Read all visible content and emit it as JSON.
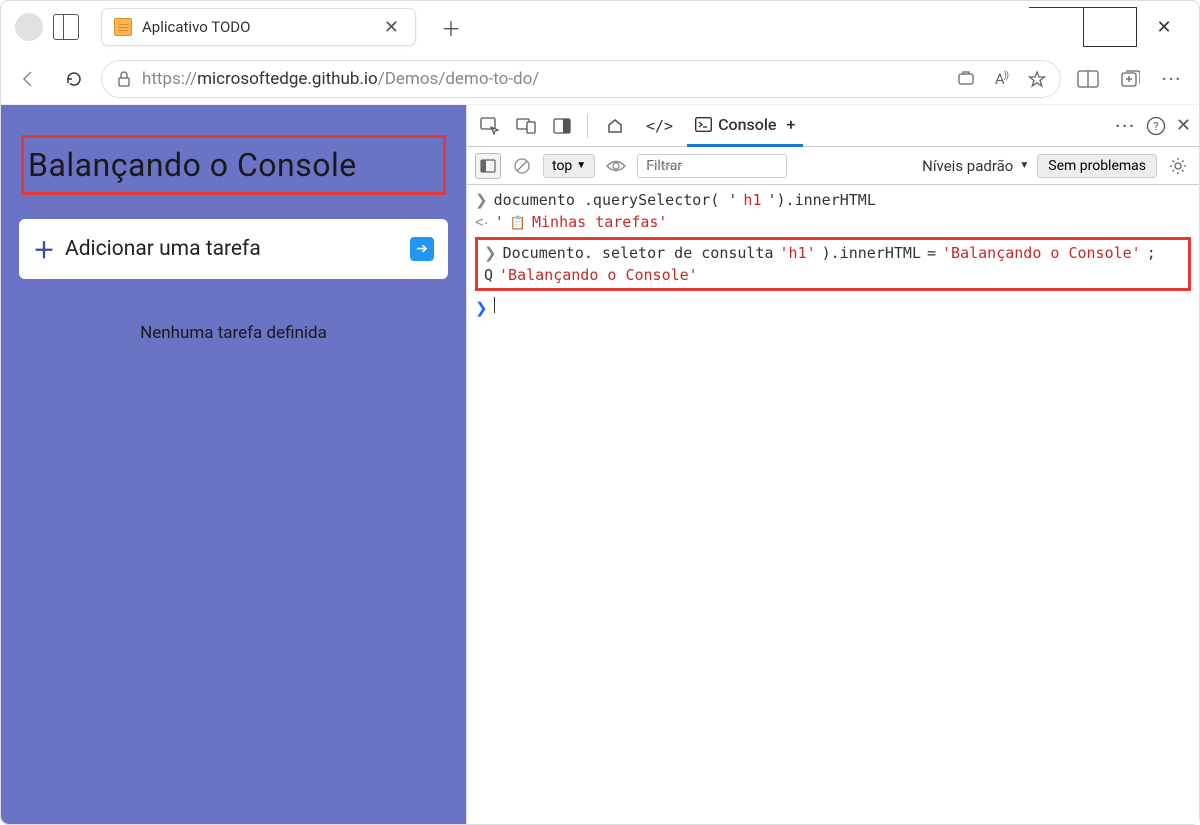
{
  "browser": {
    "tab_title": "Aplicativo TODO",
    "url_prefix": "https://",
    "url_host": "microsoftedge.github.io",
    "url_path": "/Demos/demo-to-do/"
  },
  "page": {
    "h1": "Balançando o Console",
    "add_task_label": "Adicionar uma tarefa",
    "no_tasks": "Nenhuma tarefa definida"
  },
  "devtools": {
    "console_tab": "Console",
    "toolbar": {
      "context": "top",
      "filter": "Filtrar",
      "levels": "Níveis padrão",
      "status": "Sem problemas"
    },
    "lines": {
      "l1_a": "documento .querySelector( '",
      "l1_b": "h1",
      "l1_c": "').innerHTML",
      "l2_a": "'",
      "l2_b": "Minhas tarefas'",
      "l3_a": "Documento. seletor de consulta",
      "l3_b": "'h1'",
      "l3_c": ").innerHTML",
      "l3_d": "=",
      "l3_e": "'Balançando o    Console'",
      "l3_f": ";",
      "l4_a": "Q",
      "l4_b": "'Balançando o      Console'"
    }
  }
}
